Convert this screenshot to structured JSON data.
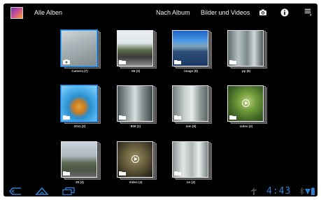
{
  "actionbar": {
    "title": "Alle Alben",
    "tabs": [
      {
        "label": "Nach Album"
      },
      {
        "label": "Bilder und Videos"
      }
    ],
    "icons": [
      "camera-icon",
      "info-icon",
      "overflow-menu-icon"
    ]
  },
  "albums": [
    {
      "label": "Camera (7)",
      "kind": "camera",
      "selected": true
    },
    {
      "label": "S6 (3)",
      "kind": "photo"
    },
    {
      "label": "image (9)",
      "kind": "photo"
    },
    {
      "label": "pp (8)",
      "kind": "photo"
    },
    {
      "label": "2011 (2)",
      "kind": "photo",
      "selected": true
    },
    {
      "label": "809 (1)",
      "kind": "photo"
    },
    {
      "label": "mm (8)",
      "kind": "photo"
    },
    {
      "label": "video (2)",
      "kind": "video"
    },
    {
      "label": "25 (4)",
      "kind": "photo"
    },
    {
      "label": "Video (4)",
      "kind": "video"
    },
    {
      "label": "nn (3)",
      "kind": "photo"
    }
  ],
  "statusbar": {
    "time": "4:43"
  },
  "colors": {
    "background": "#000000",
    "accent": "#2d7fcf",
    "selection": "#41a8ff"
  }
}
